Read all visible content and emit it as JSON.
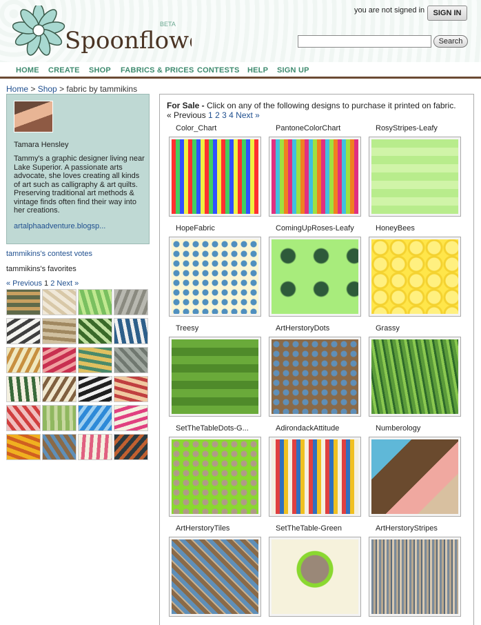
{
  "header": {
    "logo_text": "Spoonflower",
    "logo_beta": "BETA",
    "status": "you are not signed in",
    "signin_label": "SIGN IN",
    "search_placeholder": "",
    "search_label": "Search"
  },
  "nav": [
    "HOME",
    "CREATE",
    "SHOP",
    "FABRICS & PRICES",
    "CONTESTS",
    "HELP",
    "SIGN UP"
  ],
  "breadcrumb": {
    "home": "Home",
    "sep1": " > ",
    "shop": "Shop",
    "rest": " > fabric by tammikins"
  },
  "profile": {
    "name": "Tamara Hensley",
    "bio": "Tammy's a graphic designer living near Lake Superior. A passionate arts advocate, she loves creating all kinds of art such as calligraphy & art quilts. Preserving traditional art methods & vintage finds often find their way into her creations.",
    "link": "artalphaadventure.blogsp..."
  },
  "sidebar": {
    "contest_votes": "tammikins's contest votes",
    "favorites": "tammikins's favorites",
    "pager": {
      "prev": "« Previous",
      "p1": "1",
      "p2": "2",
      "next": "Next »"
    }
  },
  "main": {
    "for_sale_bold": "For Sale -",
    "for_sale_text": " Click on any of the following designs to purchase it printed on fabric.",
    "pager": {
      "prev": "« Previous",
      "p1": "1",
      "p2": "2",
      "p3": "3",
      "p4": "4",
      "next": "Next »"
    }
  },
  "designs": [
    {
      "title": "Color_Chart",
      "colors": [
        "#ff3030",
        "#40d060",
        "#3050ff",
        "#f0f040"
      ],
      "style": "grid"
    },
    {
      "title": "PantoneColorChart",
      "colors": [
        "#e03080",
        "#40c0e0",
        "#a0e040",
        "#f08020"
      ],
      "style": "grid"
    },
    {
      "title": "RosyStripes-Leafy",
      "colors": [
        "#b8ec8c",
        "#8cd870",
        "#d0f4a8",
        "#7ac060"
      ],
      "style": "stripes"
    },
    {
      "title": "HopeFabric",
      "colors": [
        "#fbf6d4",
        "#4f8fbf",
        "#7fb0d8",
        "#2e5f8a"
      ],
      "style": "dots"
    },
    {
      "title": "ComingUpRoses-Leafy",
      "colors": [
        "#a8ec7c",
        "#2e5a3a",
        "#7ad060",
        "#4f8a5a"
      ],
      "style": "roses"
    },
    {
      "title": "HoneyBees",
      "colors": [
        "#ffe64a",
        "#f4d230",
        "#fff080",
        "#3a2a10"
      ],
      "style": "hex"
    },
    {
      "title": "Treesy",
      "colors": [
        "#6aaa3a",
        "#9ad060",
        "#4f8a2a",
        "#c0e890"
      ],
      "style": "stripes"
    },
    {
      "title": "ArtHerstoryDots",
      "colors": [
        "#8a6a48",
        "#5f8fb8",
        "#a88a68",
        "#3a5a7a"
      ],
      "style": "dots"
    },
    {
      "title": "Grassy",
      "colors": [
        "#5a9a3a",
        "#8ac850",
        "#2e6a2a",
        "#f4f4e0"
      ],
      "style": "grass"
    },
    {
      "title": "SetTheTableDots-G...",
      "colors": [
        "#8ad830",
        "#b09a88",
        "#f4f0e8",
        "#6aa820"
      ],
      "style": "dots"
    },
    {
      "title": "AdirondackAttitude",
      "colors": [
        "#f4f0e0",
        "#e04040",
        "#3070c0",
        "#f0c020"
      ],
      "style": "grid"
    },
    {
      "title": "Numberology",
      "colors": [
        "#6a4a2e",
        "#5fb8d8",
        "#f0a8a0",
        "#d8c0a0"
      ],
      "style": "numbers"
    },
    {
      "title": "ArtHerstoryTiles",
      "colors": [
        "#5f8fb8",
        "#8a6a48",
        "#c8b090",
        "#3a5a7a"
      ],
      "style": "tiles"
    },
    {
      "title": "SetTheTable-Green",
      "colors": [
        "#f6f2dc",
        "#8ad830",
        "#9a8878",
        "#6a5a4a"
      ],
      "style": "plate"
    },
    {
      "title": "ArtHerstoryStripes",
      "colors": [
        "#7a8a9a",
        "#b8a890",
        "#5a6a7a",
        "#d8c8b0"
      ],
      "style": "vstripes"
    }
  ],
  "favorites_tiles": [
    [
      "#5f6a4a",
      "#c8a060"
    ],
    [
      "#f0e8d8",
      "#d8c8a8"
    ],
    [
      "#7ac060",
      "#c0e890"
    ],
    [
      "#b8b8b0",
      "#8a8a80"
    ],
    [
      "#f4f4f0",
      "#404040"
    ],
    [
      "#d0c0a0",
      "#a08860"
    ],
    [
      "#3a6a2a",
      "#c0e0a0"
    ],
    [
      "#2e5f8a",
      "#f0f0f0"
    ],
    [
      "#f0e8c0",
      "#c89040"
    ],
    [
      "#c83050",
      "#f0a0a0"
    ],
    [
      "#e0c060",
      "#4a8a6a"
    ],
    [
      "#a0a8a0",
      "#707870"
    ],
    [
      "#f4f0e0",
      "#3a6a3a"
    ],
    [
      "#f0e8d0",
      "#806040"
    ],
    [
      "#202020",
      "#f0f0f0"
    ],
    [
      "#f0c8a0",
      "#c04040"
    ],
    [
      "#f0c0c0",
      "#d04040"
    ],
    [
      "#90b860",
      "#c8d8a0"
    ],
    [
      "#2e8ad8",
      "#a0d0f0"
    ],
    [
      "#f4f0e0",
      "#e04080"
    ],
    [
      "#f0b020",
      "#d06020"
    ],
    [
      "#8a6a48",
      "#5f8fb8"
    ],
    [
      "#f4f0e0",
      "#e06080"
    ],
    [
      "#2a3a40",
      "#c06030"
    ]
  ]
}
